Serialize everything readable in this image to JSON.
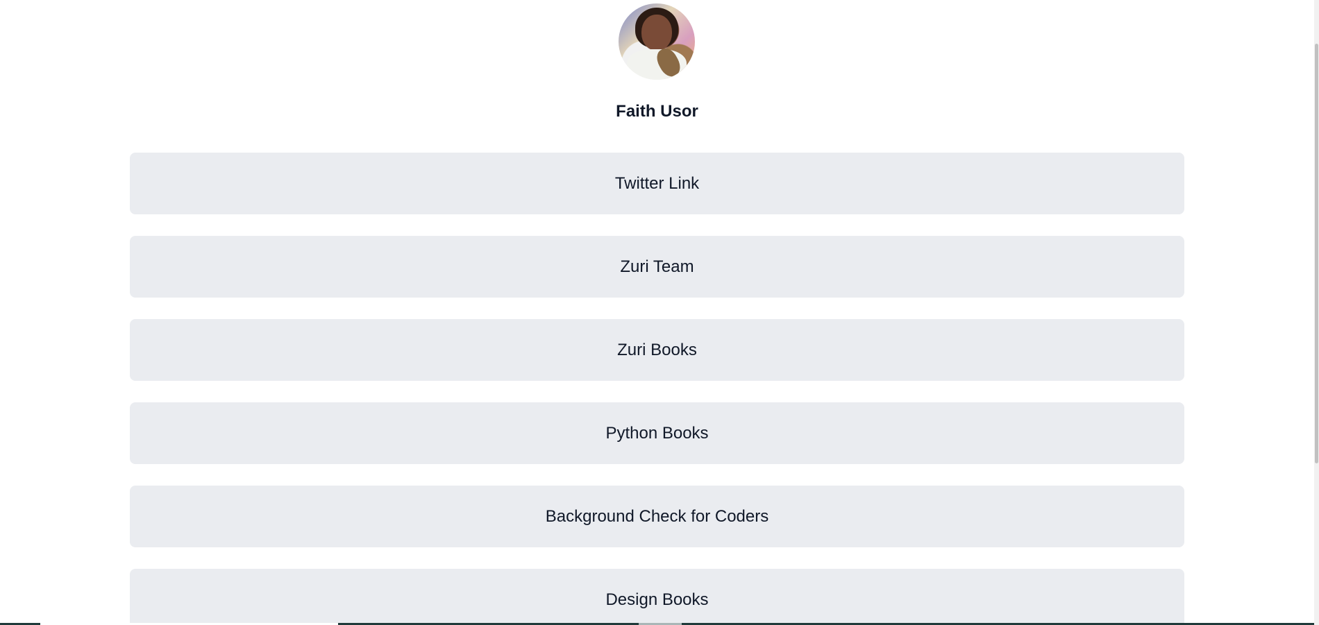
{
  "profile": {
    "name": "Faith Usor",
    "avatar_icon": "profile-photo"
  },
  "links": [
    {
      "label": "Twitter Link"
    },
    {
      "label": "Zuri Team"
    },
    {
      "label": "Zuri Books"
    },
    {
      "label": "Python Books"
    },
    {
      "label": "Background Check for Coders"
    },
    {
      "label": "Design Books"
    }
  ],
  "colors": {
    "page_background": "#ffffff",
    "button_background": "#eaecf0",
    "text": "#101828"
  }
}
